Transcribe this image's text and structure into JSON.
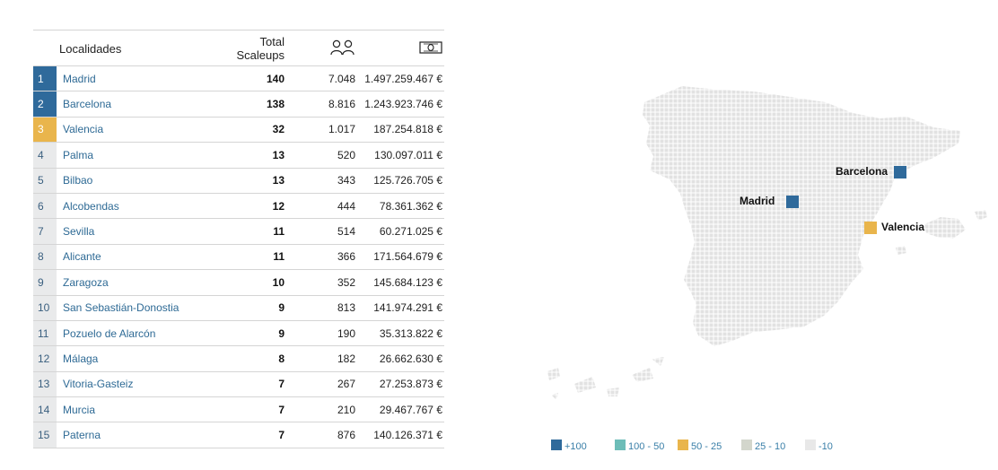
{
  "table": {
    "headers": {
      "locality": "Localidades",
      "total_line1": "Total",
      "total_line2": "Scaleups",
      "people_icon": "people-icon",
      "money_icon": "banknote-icon"
    },
    "rows": [
      {
        "rank": "1",
        "city": "Madrid",
        "total": "140",
        "employees": "7.048",
        "investment": "1.497.259.467 €",
        "tier": "blue"
      },
      {
        "rank": "2",
        "city": "Barcelona",
        "total": "138",
        "employees": "8.816",
        "investment": "1.243.923.746 €",
        "tier": "blue"
      },
      {
        "rank": "3",
        "city": "Valencia",
        "total": "32",
        "employees": "1.017",
        "investment": "187.254.818 €",
        "tier": "gold"
      },
      {
        "rank": "4",
        "city": "Palma",
        "total": "13",
        "employees": "520",
        "investment": "130.097.011 €",
        "tier": "none"
      },
      {
        "rank": "5",
        "city": "Bilbao",
        "total": "13",
        "employees": "343",
        "investment": "125.726.705 €",
        "tier": "none"
      },
      {
        "rank": "6",
        "city": "Alcobendas",
        "total": "12",
        "employees": "444",
        "investment": "78.361.362 €",
        "tier": "none"
      },
      {
        "rank": "7",
        "city": "Sevilla",
        "total": "11",
        "employees": "514",
        "investment": "60.271.025 €",
        "tier": "none"
      },
      {
        "rank": "8",
        "city": "Alicante",
        "total": "11",
        "employees": "366",
        "investment": "171.564.679 €",
        "tier": "none"
      },
      {
        "rank": "9",
        "city": "Zaragoza",
        "total": "10",
        "employees": "352",
        "investment": "145.684.123 €",
        "tier": "none"
      },
      {
        "rank": "10",
        "city": "San Sebastián-Donostia",
        "total": "9",
        "employees": "813",
        "investment": "141.974.291 €",
        "tier": "none"
      },
      {
        "rank": "11",
        "city": "Pozuelo de Alarcón",
        "total": "9",
        "employees": "190",
        "investment": "35.313.822 €",
        "tier": "none"
      },
      {
        "rank": "12",
        "city": "Málaga",
        "total": "8",
        "employees": "182",
        "investment": "26.662.630 €",
        "tier": "none"
      },
      {
        "rank": "13",
        "city": "Vitoria-Gasteiz",
        "total": "7",
        "employees": "267",
        "investment": "27.253.873 €",
        "tier": "none"
      },
      {
        "rank": "14",
        "city": "Murcia",
        "total": "7",
        "employees": "210",
        "investment": "29.467.767 €",
        "tier": "none"
      },
      {
        "rank": "15",
        "city": "Paterna",
        "total": "7",
        "employees": "876",
        "investment": "140.126.371 €",
        "tier": "none"
      }
    ]
  },
  "map": {
    "markers": [
      {
        "name": "Barcelona",
        "color": "#2f6a9b"
      },
      {
        "name": "Madrid",
        "color": "#2f6a9b"
      },
      {
        "name": "Valencia",
        "color": "#e9b54c"
      }
    ]
  },
  "legend": [
    {
      "label": "+100",
      "color": "#2f6a9b"
    },
    {
      "label": "100 - 50",
      "color": "#6dbdb8"
    },
    {
      "label": "50 - 25",
      "color": "#e9b54c"
    },
    {
      "label": "25 - 10",
      "color": "#d3d6cc"
    },
    {
      "label": "-10",
      "color": "#e8e8e8"
    }
  ],
  "chart_data": {
    "type": "table",
    "columns": [
      "Localidades",
      "Total Scaleups",
      "people-icon",
      "banknote-icon"
    ],
    "categories": [
      "Madrid",
      "Barcelona",
      "Valencia",
      "Palma",
      "Bilbao",
      "Alcobendas",
      "Sevilla",
      "Alicante",
      "Zaragoza",
      "San Sebastián-Donostia",
      "Pozuelo de Alarcón",
      "Málaga",
      "Vitoria-Gasteiz",
      "Murcia",
      "Paterna"
    ],
    "series": [
      {
        "name": "Total Scaleups",
        "values": [
          140,
          138,
          32,
          13,
          13,
          12,
          11,
          11,
          10,
          9,
          9,
          8,
          7,
          7,
          7
        ]
      },
      {
        "values": [
          7048,
          8816,
          1017,
          520,
          343,
          444,
          514,
          366,
          352,
          813,
          190,
          182,
          267,
          210,
          876
        ]
      },
      {
        "values": [
          1497259467,
          1243923746,
          187254818,
          130097011,
          125726705,
          78361362,
          60271025,
          171564679,
          145684123,
          141974291,
          35313822,
          26662630,
          27253873,
          29467767,
          140126371
        ]
      }
    ],
    "legend": [
      "+100",
      "100 - 50",
      "50 - 25",
      "25 - 10",
      "-10"
    ]
  }
}
